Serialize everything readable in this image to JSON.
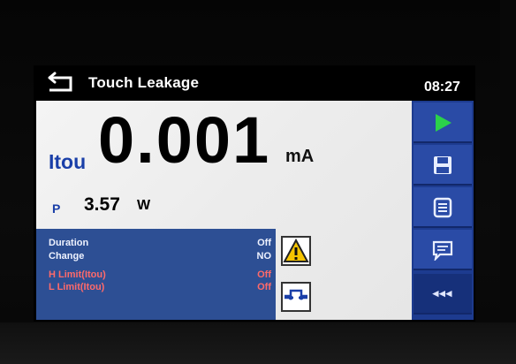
{
  "header": {
    "title": "Touch Leakage",
    "time": "08:27",
    "back_icon": "back-arrow-icon"
  },
  "measurement": {
    "label": "Itou",
    "value": "0.001",
    "unit": "mA"
  },
  "power": {
    "label": "P",
    "value": "3.57",
    "unit": "W"
  },
  "parameters": [
    {
      "name": "Duration",
      "value": "Off",
      "color": "#eef2ff"
    },
    {
      "name": "Change",
      "value": "NO",
      "color": "#eef2ff"
    },
    {
      "name": "H Limit(Itou)",
      "value": "Off",
      "color": "#ff6a6a"
    },
    {
      "name": "L Limit(Itou)",
      "value": "Off",
      "color": "#ff6a6a"
    }
  ],
  "status_icons": [
    "warning-icon",
    "connection-icon"
  ],
  "sidebar": {
    "buttons": [
      {
        "icon": "play-icon"
      },
      {
        "icon": "save-icon"
      },
      {
        "icon": "list-icon"
      },
      {
        "icon": "comment-icon"
      }
    ],
    "more_label": "◂◂◂"
  },
  "colors": {
    "accent_blue": "#1a3fa8",
    "panel_blue": "#2d4f94",
    "sidebar_blue": "#1d3b8f",
    "play_green": "#2bd14a",
    "limit_red": "#ff6a6a"
  }
}
